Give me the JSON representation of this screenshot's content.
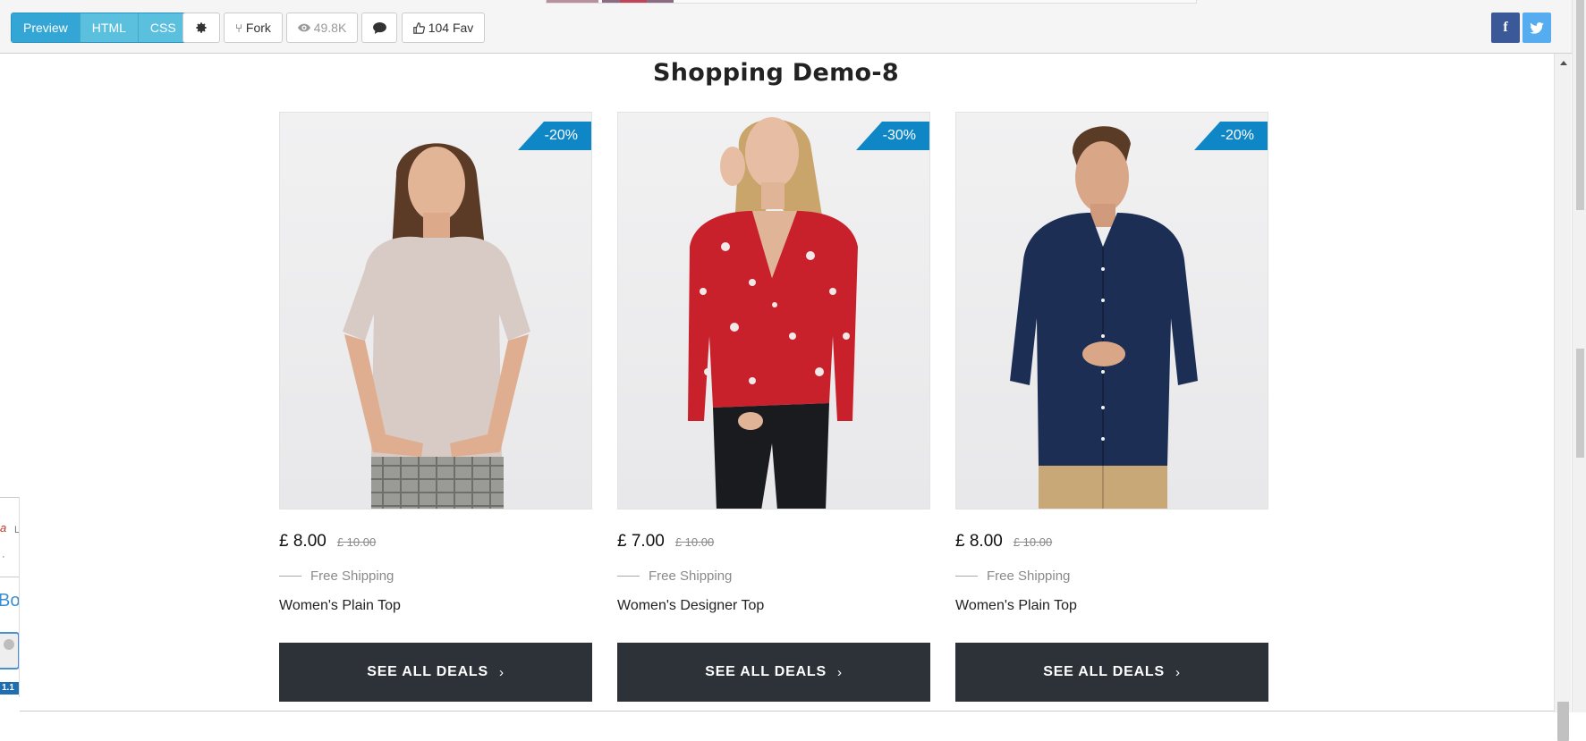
{
  "toolbar": {
    "tabs": [
      {
        "label": "Preview"
      },
      {
        "label": "HTML"
      },
      {
        "label": "CSS"
      }
    ],
    "settings_icon": "gear-icon",
    "fork_label": "Fork",
    "views_label": "49.8K",
    "comment_icon": "comment-icon",
    "fav_label": "104 Fav",
    "facebook_icon": "f",
    "twitter_icon": "twitter-bird-icon"
  },
  "side_panel": {
    "glyph1": "a",
    "text1": "L",
    "text2": "·",
    "text3": "Boc",
    "version": "1.1"
  },
  "page": {
    "title": "Shopping Demo-8"
  },
  "products": [
    {
      "discount": "-20%",
      "price": "£ 8.00",
      "old_price": "£ 10.00",
      "shipping": "Free Shipping",
      "name": "Women's Plain Top",
      "cta": "SEE ALL DEALS",
      "cta_icon": "›",
      "photo": "woman-beige-top"
    },
    {
      "discount": "-30%",
      "price": "£ 7.00",
      "old_price": "£ 10.00",
      "shipping": "Free Shipping",
      "name": "Women's Designer Top",
      "cta": "SEE ALL DEALS",
      "cta_icon": "›",
      "photo": "woman-red-floral-top"
    },
    {
      "discount": "-20%",
      "price": "£ 8.00",
      "old_price": "£ 10.00",
      "shipping": "Free Shipping",
      "name": "Women's Plain Top",
      "cta": "SEE ALL DEALS",
      "cta_icon": "›",
      "photo": "man-navy-shirt"
    }
  ],
  "colors": {
    "badge": "#0f87c7",
    "cta_background": "#2c3238",
    "preview_tab": "#33a6d6",
    "facebook": "#3b5998",
    "twitter": "#55acee"
  }
}
